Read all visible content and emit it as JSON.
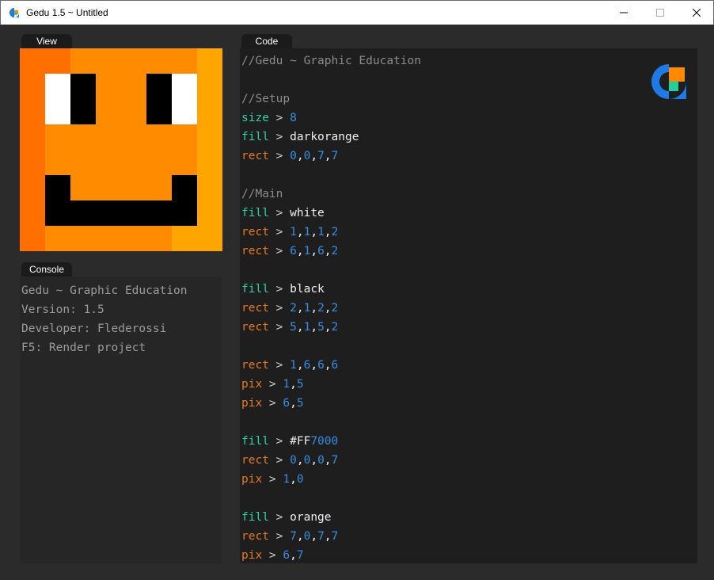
{
  "window": {
    "title": "Gedu 1.5 ~ Untitled",
    "icon": "gedu-app-icon",
    "controls": [
      "minimize-icon",
      "maximize-icon",
      "close-icon"
    ]
  },
  "tabs": {
    "view": "View",
    "console": "Console",
    "code": "Code"
  },
  "view": {
    "grid_size": 8,
    "colors": {
      "background": "#FF8C00",
      "white": "#FFFFFF",
      "black": "#000000",
      "left_column": "#FF7000",
      "right_column": "#FFA500"
    }
  },
  "console": {
    "lines": [
      "Gedu ~ Graphic Education",
      "Version: 1.5",
      "Developer: Flederossi",
      "F5: Render project"
    ]
  },
  "code": {
    "logo": "gedu-logo",
    "lines": [
      {
        "t": "comment",
        "text": "//Gedu ~ Graphic Education"
      },
      {
        "t": "blank"
      },
      {
        "t": "comment",
        "text": "//Setup"
      },
      {
        "t": "cmd",
        "cmd": "size",
        "cmd_color": "cyan",
        "args": [
          {
            "v": "8",
            "c": "blue"
          }
        ]
      },
      {
        "t": "cmd",
        "cmd": "fill",
        "cmd_color": "cyan",
        "args": [
          {
            "v": "darkorange",
            "c": "white"
          }
        ]
      },
      {
        "t": "cmd",
        "cmd": "rect",
        "cmd_color": "orange",
        "args": [
          {
            "v": "0",
            "c": "blue"
          },
          {
            "v": ",",
            "c": "white"
          },
          {
            "v": "0",
            "c": "blue"
          },
          {
            "v": ",",
            "c": "white"
          },
          {
            "v": "7",
            "c": "blue"
          },
          {
            "v": ",",
            "c": "white"
          },
          {
            "v": "7",
            "c": "blue"
          }
        ]
      },
      {
        "t": "blank"
      },
      {
        "t": "comment",
        "text": "//Main"
      },
      {
        "t": "cmd",
        "cmd": "fill",
        "cmd_color": "cyan",
        "args": [
          {
            "v": "white",
            "c": "white"
          }
        ]
      },
      {
        "t": "cmd",
        "cmd": "rect",
        "cmd_color": "orange",
        "args": [
          {
            "v": "1",
            "c": "blue"
          },
          {
            "v": ",",
            "c": "white"
          },
          {
            "v": "1",
            "c": "blue"
          },
          {
            "v": ",",
            "c": "white"
          },
          {
            "v": "1",
            "c": "blue"
          },
          {
            "v": ",",
            "c": "white"
          },
          {
            "v": "2",
            "c": "blue"
          }
        ]
      },
      {
        "t": "cmd",
        "cmd": "rect",
        "cmd_color": "orange",
        "args": [
          {
            "v": "6",
            "c": "blue"
          },
          {
            "v": ",",
            "c": "white"
          },
          {
            "v": "1",
            "c": "blue"
          },
          {
            "v": ",",
            "c": "white"
          },
          {
            "v": "6",
            "c": "blue"
          },
          {
            "v": ",",
            "c": "white"
          },
          {
            "v": "2",
            "c": "blue"
          }
        ]
      },
      {
        "t": "blank"
      },
      {
        "t": "cmd",
        "cmd": "fill",
        "cmd_color": "cyan",
        "args": [
          {
            "v": "black",
            "c": "white"
          }
        ]
      },
      {
        "t": "cmd",
        "cmd": "rect",
        "cmd_color": "orange",
        "args": [
          {
            "v": "2",
            "c": "blue"
          },
          {
            "v": ",",
            "c": "white"
          },
          {
            "v": "1",
            "c": "blue"
          },
          {
            "v": ",",
            "c": "white"
          },
          {
            "v": "2",
            "c": "blue"
          },
          {
            "v": ",",
            "c": "white"
          },
          {
            "v": "2",
            "c": "blue"
          }
        ]
      },
      {
        "t": "cmd",
        "cmd": "rect",
        "cmd_color": "orange",
        "args": [
          {
            "v": "5",
            "c": "blue"
          },
          {
            "v": ",",
            "c": "white"
          },
          {
            "v": "1",
            "c": "blue"
          },
          {
            "v": ",",
            "c": "white"
          },
          {
            "v": "5",
            "c": "blue"
          },
          {
            "v": ",",
            "c": "white"
          },
          {
            "v": "2",
            "c": "blue"
          }
        ]
      },
      {
        "t": "blank"
      },
      {
        "t": "cmd",
        "cmd": "rect",
        "cmd_color": "orange",
        "args": [
          {
            "v": "1",
            "c": "blue"
          },
          {
            "v": ",",
            "c": "white"
          },
          {
            "v": "6",
            "c": "blue"
          },
          {
            "v": ",",
            "c": "white"
          },
          {
            "v": "6",
            "c": "blue"
          },
          {
            "v": ",",
            "c": "white"
          },
          {
            "v": "6",
            "c": "blue"
          }
        ]
      },
      {
        "t": "cmd",
        "cmd": "pix",
        "cmd_color": "orange",
        "args": [
          {
            "v": "1",
            "c": "blue"
          },
          {
            "v": ",",
            "c": "white"
          },
          {
            "v": "5",
            "c": "blue"
          }
        ]
      },
      {
        "t": "cmd",
        "cmd": "pix",
        "cmd_color": "orange",
        "args": [
          {
            "v": "6",
            "c": "blue"
          },
          {
            "v": ",",
            "c": "white"
          },
          {
            "v": "5",
            "c": "blue"
          }
        ]
      },
      {
        "t": "blank"
      },
      {
        "t": "cmd",
        "cmd": "fill",
        "cmd_color": "cyan",
        "args": [
          {
            "v": "#FF",
            "c": "white"
          },
          {
            "v": "7000",
            "c": "blue"
          }
        ]
      },
      {
        "t": "cmd",
        "cmd": "rect",
        "cmd_color": "orange",
        "args": [
          {
            "v": "0",
            "c": "blue"
          },
          {
            "v": ",",
            "c": "white"
          },
          {
            "v": "0",
            "c": "blue"
          },
          {
            "v": ",",
            "c": "white"
          },
          {
            "v": "0",
            "c": "blue"
          },
          {
            "v": ",",
            "c": "white"
          },
          {
            "v": "7",
            "c": "blue"
          }
        ]
      },
      {
        "t": "cmd",
        "cmd": "pix",
        "cmd_color": "orange",
        "args": [
          {
            "v": "1",
            "c": "blue"
          },
          {
            "v": ",",
            "c": "white"
          },
          {
            "v": "0",
            "c": "blue"
          }
        ]
      },
      {
        "t": "blank"
      },
      {
        "t": "cmd",
        "cmd": "fill",
        "cmd_color": "cyan",
        "args": [
          {
            "v": "orange",
            "c": "white"
          }
        ]
      },
      {
        "t": "cmd",
        "cmd": "rect",
        "cmd_color": "orange",
        "args": [
          {
            "v": "7",
            "c": "blue"
          },
          {
            "v": ",",
            "c": "white"
          },
          {
            "v": "0",
            "c": "blue"
          },
          {
            "v": ",",
            "c": "white"
          },
          {
            "v": "7",
            "c": "blue"
          },
          {
            "v": ",",
            "c": "white"
          },
          {
            "v": "7",
            "c": "blue"
          }
        ]
      },
      {
        "t": "cmd",
        "cmd": "pix",
        "cmd_color": "orange",
        "args": [
          {
            "v": "6",
            "c": "blue"
          },
          {
            "v": ",",
            "c": "white"
          },
          {
            "v": "7",
            "c": "blue"
          }
        ]
      }
    ],
    "operator": ">"
  }
}
